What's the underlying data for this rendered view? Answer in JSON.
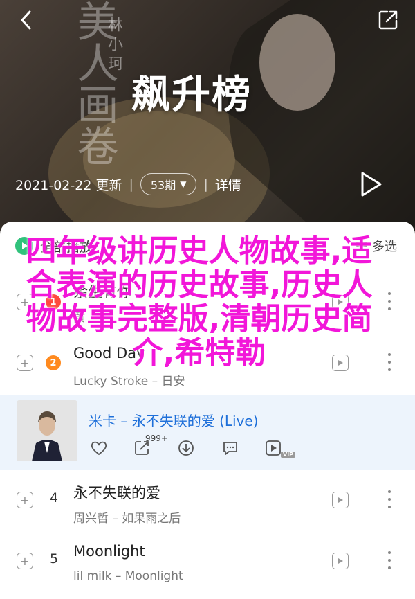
{
  "header": {
    "cover_calligraphy": "美人画卷",
    "cover_artist": "林小珂",
    "title": "飙升榜",
    "date": "2021-02-22 更新",
    "listeners": "53期",
    "detail": "详情"
  },
  "list": {
    "play_all": "全部播放",
    "multi_select": "多选"
  },
  "overlay_text": "四年级讲历史人物故事,适合表演的历史故事,历史人物故事完整版,清朝历史简介,希特勒",
  "songs": [
    {
      "rank": "1",
      "title": "余生有你",
      "artist": "黄",
      "badge_color": "#ff4a3d"
    },
    {
      "rank": "2",
      "title": "Good Day",
      "artist": "Lucky Stroke – 日安",
      "badge_color": "#ff8a1f"
    },
    {
      "rank": "4",
      "title": "永不失联的爱",
      "artist": "周兴哲 – 如果雨之后"
    },
    {
      "rank": "5",
      "title": "Moonlight",
      "artist": "lil milk – Moonlight"
    }
  ],
  "feature": {
    "title": "米卡 – 永不失联的爱 (Live)",
    "comment_count": "999+",
    "vip_label": "VIP"
  },
  "colors": {
    "accent_green": "#31c27c",
    "feature_blue": "#1e6fd9",
    "overlay_magenta": "#f216d9"
  }
}
